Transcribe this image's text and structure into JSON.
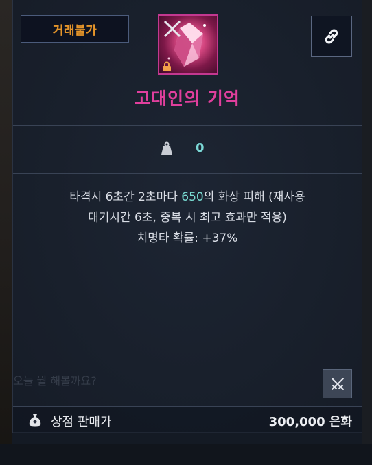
{
  "badge": {
    "label": "거래불가"
  },
  "item": {
    "name": "고대인의 기억",
    "icon": "rune-crystal-icon",
    "lock_icon": "lock-icon",
    "frame_color": "#c33890",
    "name_color": "#e13f9d"
  },
  "link_button": {
    "icon": "link-icon"
  },
  "weight": {
    "icon": "weight-icon",
    "value": "0"
  },
  "effect": {
    "line1_prefix": "타격시 6초간 2초마다 ",
    "line1_highlight": "650",
    "line1_suffix": "의 화상 피해 (재사용",
    "line2": "대기시간 6초, 중복 시 최고 효과만 적용)",
    "line3": "치명타 확률: +37%",
    "highlight_color": "#79dcd3"
  },
  "engrave_button": {
    "icon": "crossed-swords-icon"
  },
  "footer": {
    "price_icon": "money-bag-icon",
    "label": "상점 판매가",
    "value": "300,000 은화"
  },
  "background_text": "오늘 뭘 해볼까요?"
}
